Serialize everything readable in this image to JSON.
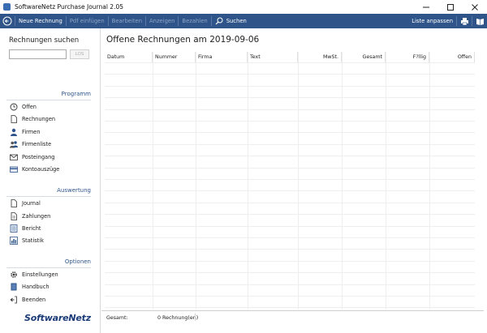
{
  "window": {
    "title": "SoftwareNetz Purchase Journal 2.05"
  },
  "toolbar": {
    "items": [
      {
        "label": "Neue Rechnung",
        "enabled": true
      },
      {
        "label": "Pdf einfügen",
        "enabled": false
      },
      {
        "label": "Bearbeiten",
        "enabled": false
      },
      {
        "label": "Anzeigen",
        "enabled": false
      },
      {
        "label": "Bezahlen",
        "enabled": false
      },
      {
        "label": "Suchen",
        "enabled": true
      }
    ],
    "customize_label": "Liste anpassen"
  },
  "sidebar": {
    "search_title": "Rechnungen suchen",
    "search_value": "",
    "search_button": "LOS",
    "sections": [
      {
        "title": "Programm",
        "items": [
          {
            "label": "Offen",
            "icon": "clock-icon"
          },
          {
            "label": "Rechnungen",
            "icon": "document-icon"
          },
          {
            "label": "Firmen",
            "icon": "person-icon"
          },
          {
            "label": "Firmenliste",
            "icon": "people-icon"
          },
          {
            "label": "Posteingang",
            "icon": "envelope-icon"
          },
          {
            "label": "Kontoauszüge",
            "icon": "card-icon"
          }
        ]
      },
      {
        "title": "Auswertung",
        "items": [
          {
            "label": "Journal",
            "icon": "journal-icon"
          },
          {
            "label": "Zahlungen",
            "icon": "payments-icon"
          },
          {
            "label": "Bericht",
            "icon": "report-icon"
          },
          {
            "label": "Statistik",
            "icon": "chart-icon"
          }
        ]
      },
      {
        "title": "Optionen",
        "items": [
          {
            "label": "Einstellungen",
            "icon": "gear-icon"
          },
          {
            "label": "Handbuch",
            "icon": "book-icon"
          },
          {
            "label": "Beenden",
            "icon": "exit-icon"
          }
        ]
      }
    ],
    "logo_text": "SoftwareNetz"
  },
  "main": {
    "title": "Offene Rechnungen am 2019-09-06",
    "columns": [
      "Datum",
      "Nummer",
      "Firma",
      "Text",
      "MwSt.",
      "Gesamt",
      "F?llig",
      "Offen"
    ],
    "rows": [],
    "footer_label": "Gesamt:",
    "footer_count": "0 Rechnung(en)"
  },
  "colors": {
    "toolbar_bg": "#2e5489",
    "accent": "#2e5489"
  }
}
